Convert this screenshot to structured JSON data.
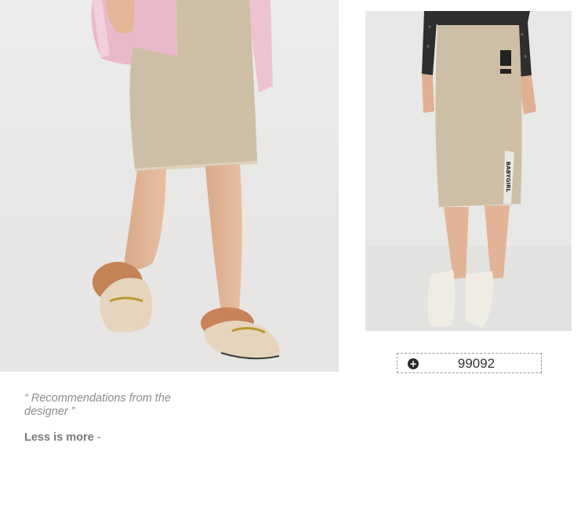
{
  "main_photo": {
    "alt": "Model in beige knit pencil skirt and fur-lined loafers"
  },
  "side_photo": {
    "alt": "Model in beige knit midi skirt with side slit and ankle boots",
    "patch_text": "BABYGIRL"
  },
  "product": {
    "code": "99092"
  },
  "designer_note": {
    "quote": "“ Recommendations from the designer ”",
    "motto": "Less is more",
    "motto_suffix": "-"
  },
  "colors": {
    "skirt": "#cdbfa5",
    "text_muted": "#8a8a8a"
  }
}
